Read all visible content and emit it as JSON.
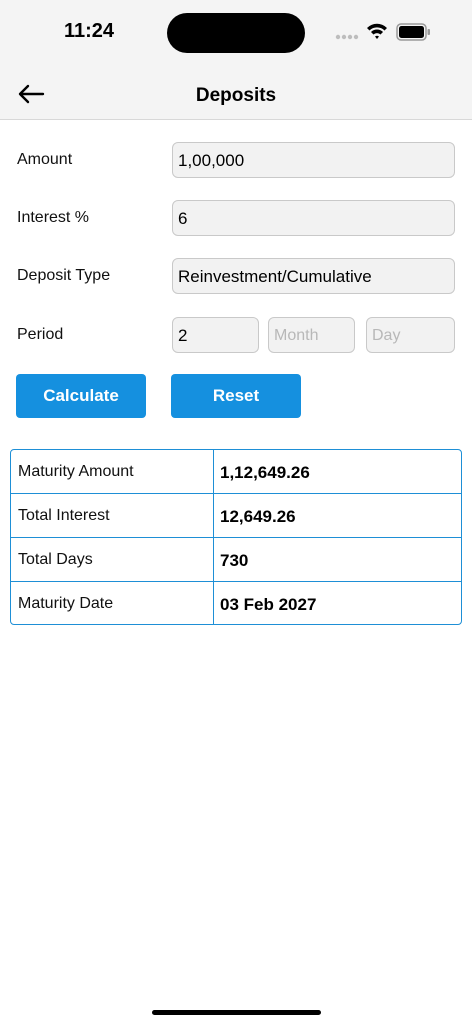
{
  "status_bar": {
    "time": "11:24"
  },
  "nav": {
    "title": "Deposits",
    "back_icon": "arrow-left-icon"
  },
  "form": {
    "amount": {
      "label": "Amount",
      "value": "1,00,000"
    },
    "interest": {
      "label": "Interest %",
      "value": "6"
    },
    "deposit_type": {
      "label": "Deposit Type",
      "value": "Reinvestment/Cumulative"
    },
    "period": {
      "label": "Period",
      "years_value": "2",
      "month_placeholder": "Month",
      "day_placeholder": "Day"
    }
  },
  "buttons": {
    "calculate": "Calculate",
    "reset": "Reset",
    "color": "#1590df"
  },
  "results": {
    "rows": [
      {
        "label": "Maturity Amount",
        "value": "1,12,649.26"
      },
      {
        "label": "Total Interest",
        "value": "12,649.26"
      },
      {
        "label": "Total Days",
        "value": "730"
      },
      {
        "label": "Maturity Date",
        "value": "03 Feb 2027"
      }
    ],
    "border_color": "#1e8fd6"
  }
}
